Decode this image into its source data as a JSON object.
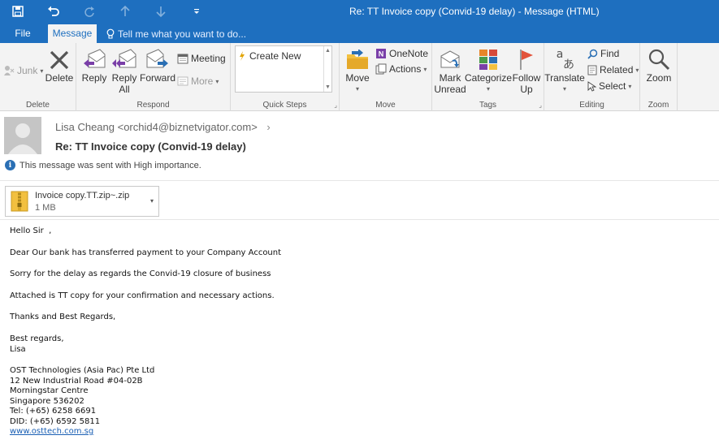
{
  "window": {
    "title": "Re: TT Invoice copy (Convid-19 delay) - Message (HTML)"
  },
  "quick_access": {
    "icons": [
      "save-icon",
      "undo-icon",
      "redo-icon",
      "up-arrow-icon",
      "down-arrow-icon",
      "customize-icon"
    ]
  },
  "tabs": {
    "file": "File",
    "message": "Message",
    "tell_me": "Tell me what you want to do..."
  },
  "ribbon": {
    "delete_group": {
      "junk": "Junk",
      "delete": "Delete",
      "label": "Delete"
    },
    "respond_group": {
      "reply": "Reply",
      "reply_all_1": "Reply",
      "reply_all_2": "All",
      "forward": "Forward",
      "meeting": "Meeting",
      "more": "More",
      "label": "Respond"
    },
    "quick_steps_group": {
      "create_new": "Create New",
      "label": "Quick Steps"
    },
    "move_group": {
      "move": "Move",
      "onenote": "OneNote",
      "actions": "Actions",
      "label": "Move"
    },
    "tags_group": {
      "mark_unread_1": "Mark",
      "mark_unread_2": "Unread",
      "categorize": "Categorize",
      "follow_up_1": "Follow",
      "follow_up_2": "Up",
      "label": "Tags"
    },
    "editing_group": {
      "translate": "Translate",
      "find": "Find",
      "related": "Related",
      "select": "Select",
      "label": "Editing"
    },
    "zoom_group": {
      "zoom": "Zoom",
      "label": "Zoom"
    }
  },
  "message": {
    "sender": "Lisa Cheang <orchid4@biznetvigator.com>",
    "subject": "Re: TT Invoice copy (Convid-19 delay)",
    "importance": "This message was sent with High importance.",
    "attachment": {
      "name": "Invoice copy.TT.zip~.zip",
      "size": "1 MB"
    }
  },
  "body": {
    "greeting": "Hello Sir  ,",
    "line1": "Dear Our bank has transferred payment to your Company Account",
    "line2": "Sorry for the delay as regards the Convid-19 closure of business",
    "line3": "Attached is TT copy for your confirmation and necessary actions.",
    "thanks": "Thanks and Best Regards,",
    "regards": "Best regards,",
    "name": "Lisa",
    "signature": [
      "OST Technologies (Asia Pac) Pte Ltd",
      "12 New Industrial Road #04-02B",
      "Morningstar Centre",
      "Singapore 536202",
      "Tel: (+65) 6258 6691",
      "DID: (+65) 6592 5811"
    ],
    "website": "www.osttech.com.sg"
  }
}
